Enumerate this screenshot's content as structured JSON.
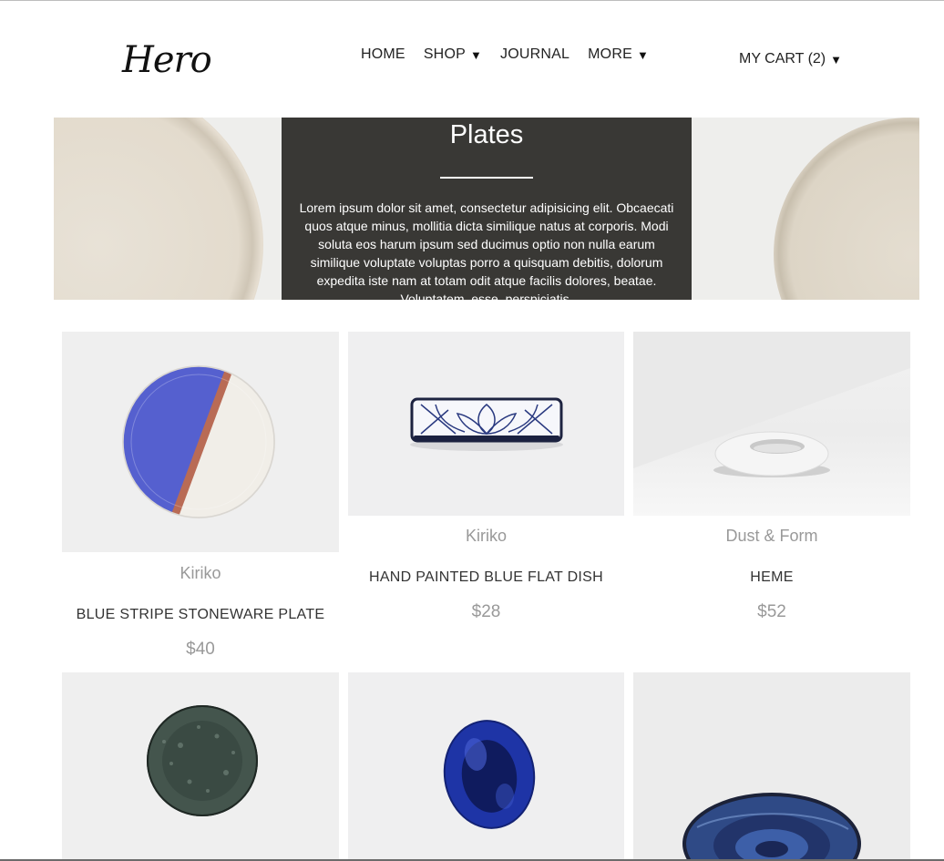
{
  "header": {
    "logo": "Hero",
    "nav": [
      {
        "label": "HOME",
        "has_caret": false
      },
      {
        "label": "SHOP",
        "has_caret": true
      },
      {
        "label": "JOURNAL",
        "has_caret": false
      },
      {
        "label": "MORE",
        "has_caret": true
      }
    ],
    "cart_label": "MY CART (2)",
    "caret": "▼"
  },
  "hero": {
    "title": "Plates",
    "text": "Lorem ipsum dolor sit amet, consectetur adipisicing elit. Obcaecati quos atque minus, mollitia dicta similique natus at corporis. Modi soluta eos harum ipsum sed ducimus optio non nulla earum similique voluptate voluptas porro a quisquam debitis, dolorum expedita iste nam at totam odit atque facilis dolores, beatae. Voluptatem, esse, perspiciatis."
  },
  "products": [
    {
      "brand": "Kiriko",
      "name": "BLUE STRIPE STONEWARE PLATE",
      "price": "$40",
      "image": "blue-stripe-plate"
    },
    {
      "brand": "Kiriko",
      "name": "HAND PAINTED BLUE FLAT DISH",
      "price": "$28",
      "image": "blue-flat-dish"
    },
    {
      "brand": "Dust & Form",
      "name": "HEME",
      "price": "$52",
      "image": "white-ring-bowl"
    },
    {
      "brand": "",
      "name": "",
      "price": "",
      "image": "dark-green-plate"
    },
    {
      "brand": "",
      "name": "",
      "price": "",
      "image": "cobalt-oval-dish"
    },
    {
      "brand": "",
      "name": "",
      "price": "",
      "image": "blue-swirl-platter"
    }
  ],
  "colors": {
    "hero_card": "#393835",
    "muted_text": "#999999",
    "body_text": "#333333"
  }
}
